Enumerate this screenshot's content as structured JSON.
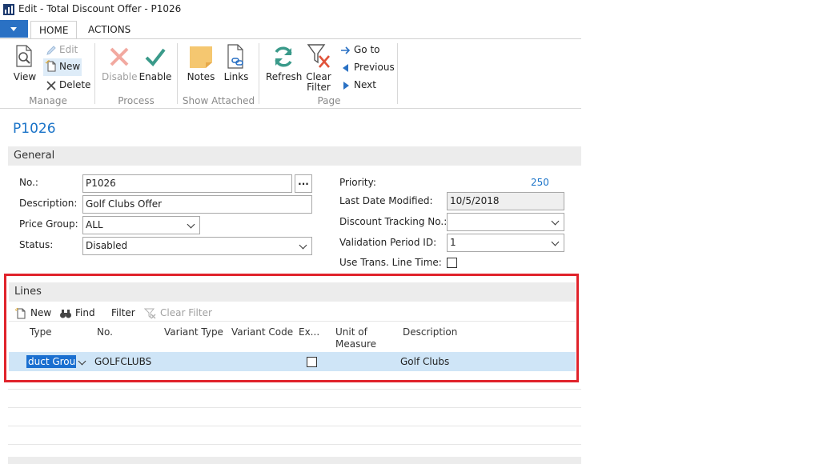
{
  "window": {
    "title": "Edit - Total Discount Offer - P1026"
  },
  "ribbon": {
    "tabs": [
      "HOME",
      "ACTIONS"
    ],
    "manage": {
      "label": "Manage",
      "view": "View",
      "edit": "Edit",
      "new": "New",
      "delete": "Delete"
    },
    "process": {
      "label": "Process",
      "disable": "Disable",
      "enable": "Enable"
    },
    "show_attached": {
      "label": "Show Attached",
      "notes": "Notes",
      "links": "Links"
    },
    "page": {
      "label": "Page",
      "refresh": "Refresh",
      "clear_filter_1": "Clear",
      "clear_filter_2": "Filter",
      "go_to": "Go to",
      "previous": "Previous",
      "next": "Next"
    }
  },
  "page_title": "P1026",
  "general": {
    "header": "General",
    "no_label": "No.:",
    "no_value": "P1026",
    "lookup": "...",
    "description_label": "Description:",
    "description_value": "Golf Clubs Offer",
    "price_group_label": "Price Group:",
    "price_group_value": "ALL",
    "status_label": "Status:",
    "status_value": "Disabled",
    "priority_label": "Priority:",
    "priority_value": "250",
    "last_modified_label": "Last Date Modified:",
    "last_modified_value": "10/5/2018",
    "discount_tracking_label": "Discount Tracking No.:",
    "discount_tracking_value": "",
    "validation_period_label": "Validation Period ID:",
    "validation_period_value": "1",
    "use_trans_label": "Use Trans. Line Time:"
  },
  "lines": {
    "header": "Lines",
    "toolbar": {
      "new": "New",
      "find": "Find",
      "filter": "Filter",
      "clear_filter": "Clear Filter"
    },
    "columns": {
      "type": "Type",
      "no": "No.",
      "variant_type": "Variant Type",
      "variant_code": "Variant Code",
      "ex": "Ex...",
      "uom_1": "Unit of",
      "uom_2": "Measure",
      "description": "Description"
    },
    "row": {
      "type": "duct Group",
      "no": "GOLFCLUBS",
      "description": "Golf Clubs"
    }
  },
  "colors": {
    "accent": "#1a73c8",
    "highlight_box": "#e0232b",
    "row_selected": "#cfe5f7"
  }
}
